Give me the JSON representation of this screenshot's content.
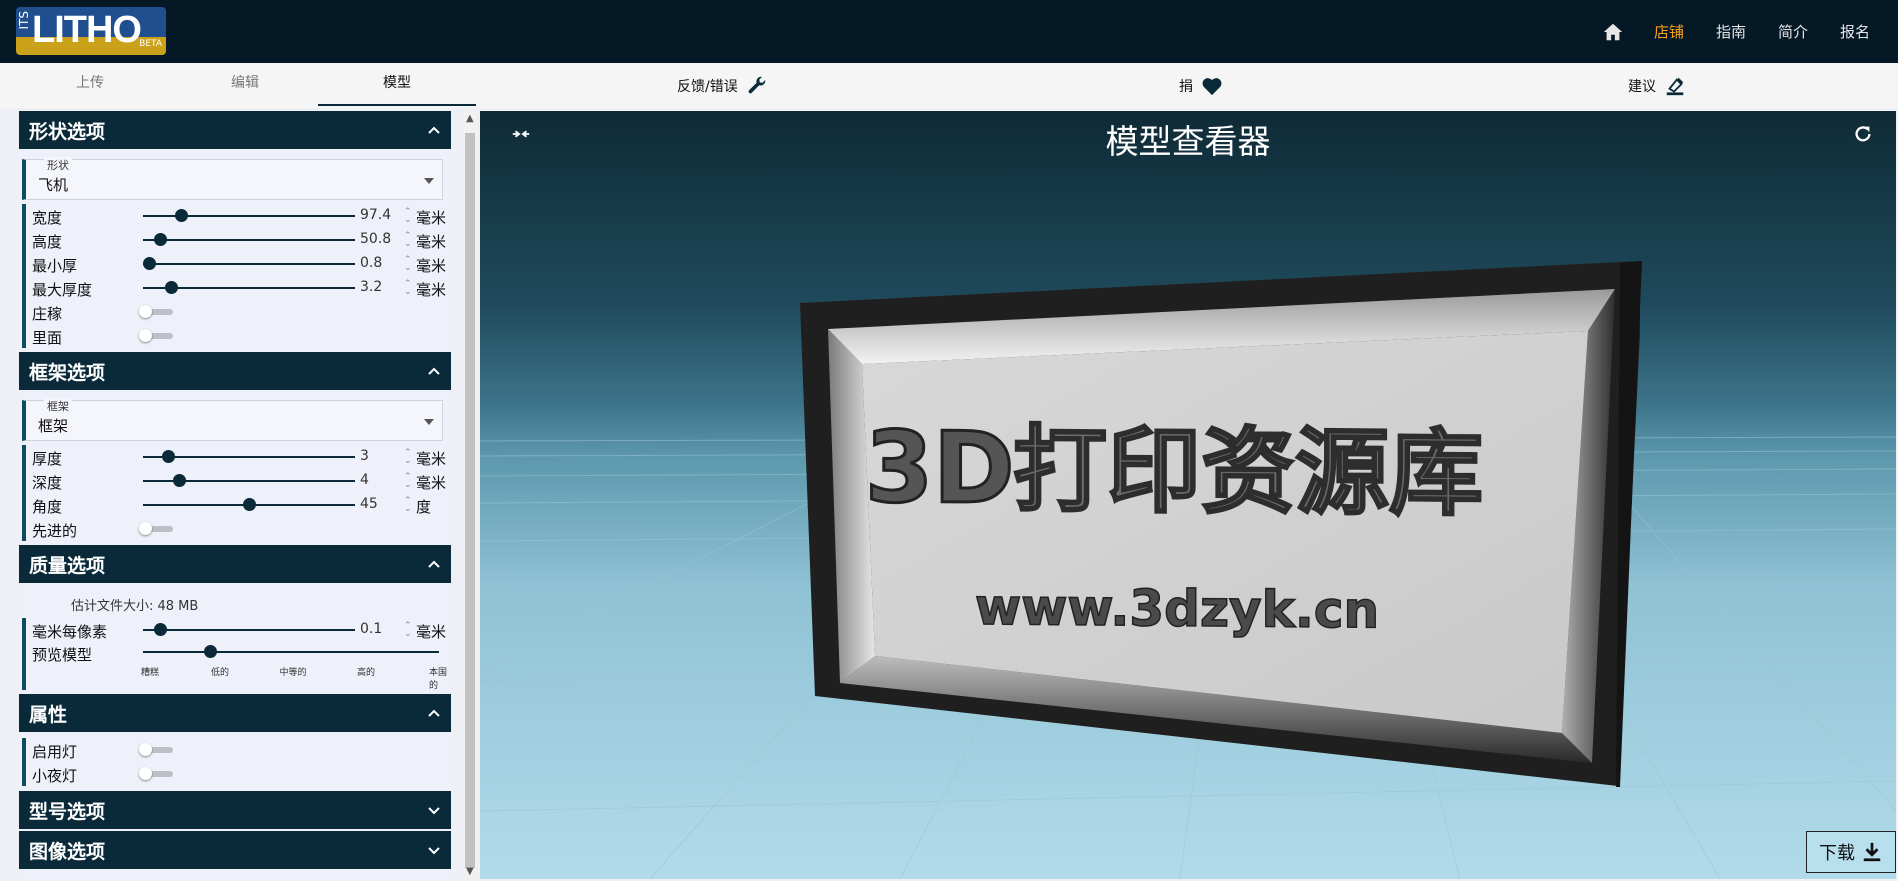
{
  "logo": {
    "prefix": "ITS",
    "main": "LITHO",
    "badge": "BETA"
  },
  "nav": {
    "links": [
      {
        "label": "店铺",
        "active": true
      },
      {
        "label": "指南",
        "active": false
      },
      {
        "label": "简介",
        "active": false
      },
      {
        "label": "报名",
        "active": false
      }
    ],
    "home_icon": "home-icon"
  },
  "tabs": [
    {
      "label": "上传",
      "active": false
    },
    {
      "label": "编辑",
      "active": false
    },
    {
      "label": "模型",
      "active": true
    }
  ],
  "actions": {
    "feedback": {
      "label": "反馈/错误",
      "icon": "wrench-icon"
    },
    "donate": {
      "label": "捐",
      "icon": "heart-icon"
    },
    "suggest": {
      "label": "建议",
      "icon": "pen-icon"
    }
  },
  "sidebar": {
    "shape": {
      "title": "形状选项",
      "select": {
        "legend": "形状",
        "value": "飞机"
      },
      "sliders": [
        {
          "label": "宽度",
          "value": "97.4",
          "unit": "毫米",
          "fraction": 0.18
        },
        {
          "label": "高度",
          "value": "50.8",
          "unit": "毫米",
          "fraction": 0.08
        },
        {
          "label": "最小厚",
          "value": "0.8",
          "unit": "毫米",
          "fraction": 0.03
        },
        {
          "label": "最大厚度",
          "value": "3.2",
          "unit": "毫米",
          "fraction": 0.13
        }
      ],
      "toggles": [
        {
          "label": "庄稼",
          "on": false
        },
        {
          "label": "里面",
          "on": false
        }
      ]
    },
    "frame": {
      "title": "框架选项",
      "select": {
        "legend": "框架",
        "value": "框架"
      },
      "sliders": [
        {
          "label": "厚度",
          "value": "3",
          "unit": "毫米",
          "fraction": 0.12
        },
        {
          "label": "深度",
          "value": "4",
          "unit": "毫米",
          "fraction": 0.17
        },
        {
          "label": "角度",
          "value": "45",
          "unit": "度",
          "fraction": 0.5
        }
      ],
      "toggles": [
        {
          "label": "先进的",
          "on": false
        }
      ]
    },
    "quality": {
      "title": "质量选项",
      "estimate": "估计文件大小:  48 MB",
      "sliders": [
        {
          "label": "毫米每像素",
          "value": "0.1",
          "unit": "毫米",
          "fraction": 0.08
        }
      ],
      "preview": {
        "label": "预览模型",
        "levels": [
          "糟糕",
          "低的",
          "中等的",
          "高的",
          "本国的"
        ],
        "selected": 1
      }
    },
    "properties": {
      "title": "属性",
      "toggles": [
        {
          "label": "启用灯",
          "on": false
        },
        {
          "label": "小夜灯",
          "on": false
        }
      ]
    },
    "model": {
      "title": "型号选项"
    },
    "image": {
      "title": "图像选项"
    }
  },
  "viewer": {
    "title": "模型查看器",
    "plaque_text_main": "打印资源库",
    "plaque_text_logo": "3D",
    "plaque_text_url": "www.3dzyk.cn",
    "download_label": "下载",
    "collapse_icon": "collapse-icon",
    "refresh_icon": "refresh-icon",
    "download_icon": "download-icon"
  },
  "colors": {
    "navbar": "#051826",
    "accent_active": "#f7a11a",
    "section_header": "#0a2a3a"
  }
}
